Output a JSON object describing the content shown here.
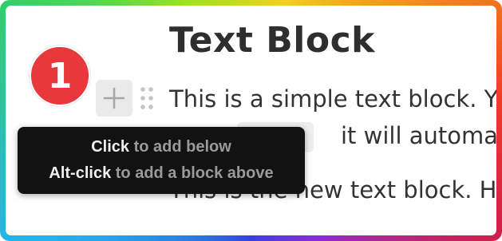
{
  "document": {
    "title": "Text Block",
    "paragraphs": [
      "This is a simple text block. You",
      "it will automatic",
      "This is the new text block. Ho"
    ]
  },
  "block_controls": {
    "add_icon": "plus-icon",
    "drag_icon": "drag-handle-icon"
  },
  "step_badge": {
    "number": "1",
    "color": "#e8383d"
  },
  "tooltip": {
    "line1_action": "Click",
    "line1_desc": " to add below",
    "line2_action": "Alt-click",
    "line2_desc": " to add a block above"
  }
}
